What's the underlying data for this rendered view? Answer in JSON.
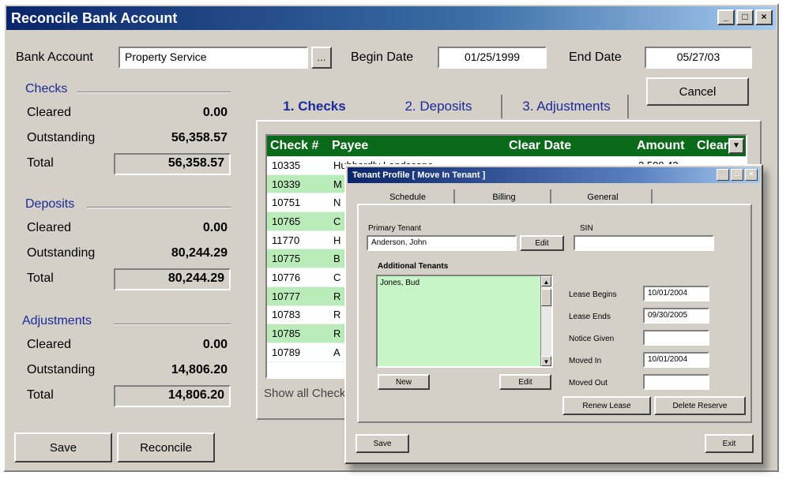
{
  "window": {
    "title": "Reconcile Bank Account"
  },
  "header": {
    "bank_account_label": "Bank Account",
    "bank_account_value": "Property Service",
    "begin_date_label": "Begin Date",
    "begin_date_value": "01/25/1999",
    "end_date_label": "End Date",
    "end_date_value": "05/27/03",
    "cancel_label": "Cancel"
  },
  "checks": {
    "title": "Checks",
    "cleared_label": "Cleared",
    "cleared_value": "0.00",
    "outstanding_label": "Outstanding",
    "outstanding_value": "56,358.57",
    "total_label": "Total",
    "total_value": "56,358.57"
  },
  "deposits": {
    "title": "Deposits",
    "cleared_label": "Cleared",
    "cleared_value": "0.00",
    "outstanding_label": "Outstanding",
    "outstanding_value": "80,244.29",
    "total_label": "Total",
    "total_value": "80,244.29"
  },
  "adjustments": {
    "title": "Adjustments",
    "cleared_label": "Cleared",
    "cleared_value": "0.00",
    "outstanding_label": "Outstanding",
    "outstanding_value": "14,806.20",
    "total_label": "Total",
    "total_value": "14,806.20"
  },
  "footer": {
    "save_label": "Save",
    "reconcile_label": "Reconcile"
  },
  "tabs": [
    "1. Checks",
    "2. Deposits",
    "3. Adjustments"
  ],
  "grid": {
    "columns": [
      "Check #",
      "Payee",
      "Clear Date",
      "Amount",
      "Clear"
    ],
    "rows": [
      {
        "check": "10335",
        "payee": "Hubbardly Landscape",
        "amount": "2,500.43"
      },
      {
        "check": "10339",
        "payee": "M",
        "amount": ""
      },
      {
        "check": "10751",
        "payee": "N",
        "amount": ""
      },
      {
        "check": "10765",
        "payee": "C",
        "amount": ""
      },
      {
        "check": "11770",
        "payee": "H",
        "amount": ""
      },
      {
        "check": "10775",
        "payee": "B",
        "amount": ""
      },
      {
        "check": "10776",
        "payee": "C",
        "amount": ""
      },
      {
        "check": "10777",
        "payee": "R",
        "amount": ""
      },
      {
        "check": "10783",
        "payee": "R",
        "amount": ""
      },
      {
        "check": "10785",
        "payee": "R",
        "amount": ""
      },
      {
        "check": "10789",
        "payee": "A",
        "amount": ""
      }
    ],
    "show_all_label": "Show all Checks"
  },
  "dialog": {
    "title": "Tenant Profile  [ Move In Tenant ]",
    "tabs": [
      "Schedule",
      "Billing",
      "General"
    ],
    "primary_tenant_label": "Primary Tenant",
    "primary_tenant_value": "Anderson, John",
    "edit_label": "Edit",
    "sin_label": "SIN",
    "sin_value": "",
    "additional_tenants_label": "Additional Tenants",
    "additional_tenants": [
      "Jones, Bud"
    ],
    "new_label": "New",
    "edit2_label": "Edit",
    "lease_begins_label": "Lease Begins",
    "lease_begins_value": "10/01/2004",
    "lease_ends_label": "Lease Ends",
    "lease_ends_value": "09/30/2005",
    "notice_given_label": "Notice Given",
    "notice_given_value": "",
    "moved_in_label": "Moved In",
    "moved_in_value": "10/01/2004",
    "moved_out_label": "Moved Out",
    "moved_out_value": "",
    "renew_lease_label": "Renew Lease",
    "delete_reserve_label": "Delete Reserve",
    "save_label": "Save",
    "exit_label": "Exit"
  }
}
